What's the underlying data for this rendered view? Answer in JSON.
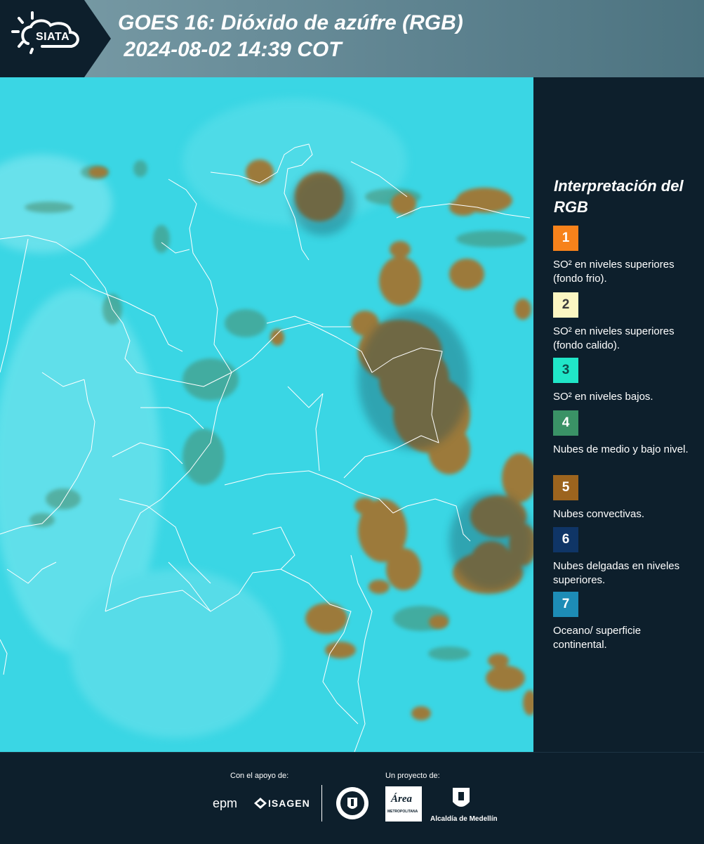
{
  "header": {
    "logo_text": "SIATA",
    "title_line1": "GOES 16: Dióxido de azúfre (RGB)",
    "title_line2": " 2024-08-02 14:39 COT"
  },
  "map": {
    "background_color": "#36d8e6",
    "cloud_color": "#9c7a3a",
    "border_color": "#ffffff"
  },
  "legend": {
    "title": "Interpretación del RGB",
    "items": [
      {
        "number": "1",
        "color": "#f7821b",
        "label": "SO² en niveles superiores (fondo frio)."
      },
      {
        "number": "2",
        "color": "#fbf6c2",
        "label": "SO² en niveles superiores (fondo calido)."
      },
      {
        "number": "3",
        "color": "#20e6c8",
        "label": "SO² en niveles bajos."
      },
      {
        "number": "4",
        "color": "#3a9266",
        "label": "Nubes de medio y bajo nivel."
      },
      {
        "number": "5",
        "color": "#9c641e",
        "label": "Nubes convectivas."
      },
      {
        "number": "6",
        "color": "#0f3566",
        "label": "Nubes delgadas en niveles superiores."
      },
      {
        "number": "7",
        "color": "#1d8cb6",
        "label": "Oceano/ superficie continental."
      }
    ]
  },
  "footer": {
    "support_label": "Con el apoyo de:",
    "project_label": "Un proyecto de:",
    "epm_text": "epm",
    "isagen_text": "ISAGEN",
    "area_text": "Área",
    "area_sub": "METROPOLITANA",
    "alcaldia_text": "Alcaldía de Medellín"
  }
}
